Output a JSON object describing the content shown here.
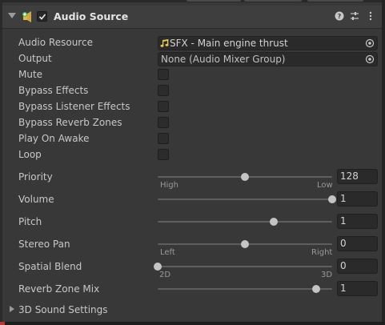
{
  "component": {
    "title": "Audio Source",
    "enabled": true,
    "icons": {
      "component": "audio-source-icon",
      "help": "help-icon",
      "presets": "presets-icon",
      "menu": "kebab-menu-icon"
    }
  },
  "fields": {
    "audio_resource": {
      "label": "Audio Resource",
      "value": "SFX - Main engine thrust"
    },
    "output": {
      "label": "Output",
      "value": "None (Audio Mixer Group)"
    },
    "mute": {
      "label": "Mute",
      "checked": false
    },
    "bypass_effects": {
      "label": "Bypass Effects",
      "checked": false
    },
    "bypass_listener_effects": {
      "label": "Bypass Listener Effects",
      "checked": false
    },
    "bypass_reverb_zones": {
      "label": "Bypass Reverb Zones",
      "checked": false
    },
    "play_on_awake": {
      "label": "Play On Awake",
      "checked": false
    },
    "loop": {
      "label": "Loop",
      "checked": false
    }
  },
  "sliders": {
    "priority": {
      "label": "Priority",
      "value": "128",
      "min": 0,
      "max": 256,
      "fraction": 0.5,
      "min_label": "High",
      "max_label": "Low"
    },
    "volume": {
      "label": "Volume",
      "value": "1",
      "min": 0,
      "max": 1,
      "fraction": 1.0
    },
    "pitch": {
      "label": "Pitch",
      "value": "1",
      "min": -3,
      "max": 3,
      "fraction": 0.667
    },
    "stereo_pan": {
      "label": "Stereo Pan",
      "value": "0",
      "min": -1,
      "max": 1,
      "fraction": 0.5,
      "min_label": "Left",
      "max_label": "Right"
    },
    "spatial_blend": {
      "label": "Spatial Blend",
      "value": "0",
      "min": 0,
      "max": 1,
      "fraction": 0.0,
      "min_label": "2D",
      "max_label": "3D"
    },
    "reverb_zone_mix": {
      "label": "Reverb Zone Mix",
      "value": "1",
      "min": 0,
      "max": 1.1,
      "fraction": 0.909
    }
  },
  "sound_settings_foldout": {
    "label": "3D Sound Settings",
    "expanded": false
  },
  "colors": {
    "accent_green": "#3fb950",
    "audio_note": "#e8c84a"
  }
}
